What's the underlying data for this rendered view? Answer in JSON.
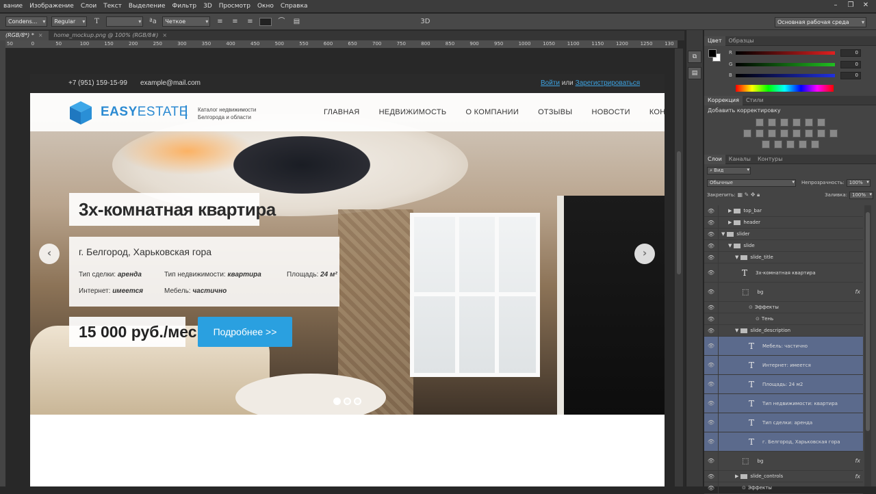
{
  "menu": [
    "вание",
    "Изображение",
    "Слои",
    "Текст",
    "Выделение",
    "Фильтр",
    "3D",
    "Просмотр",
    "Окно",
    "Справка"
  ],
  "options": {
    "font_family": "Condens...",
    "font_style": "Regular",
    "font_size": "",
    "antialias": "Четкое",
    "label_3d": "3D",
    "workspace": "Основная рабочая среда"
  },
  "tabs": [
    {
      "label": "(RGB/8*) *",
      "active": true
    },
    {
      "label": "home_mockup.png @ 100% (RGB/8#)",
      "active": false
    }
  ],
  "ruler": [
    "50",
    "0",
    "50",
    "100",
    "150",
    "200",
    "250",
    "300",
    "350",
    "400",
    "450",
    "500",
    "550",
    "600",
    "650",
    "700",
    "750",
    "800",
    "850",
    "900",
    "950",
    "1000",
    "1050",
    "1100",
    "1150",
    "1200",
    "1250",
    "130"
  ],
  "site": {
    "phone": "+7 (951) 159-15-99",
    "email": "example@mail.com",
    "login": "Войти",
    "or": "или",
    "register": "Зарегистрироваться",
    "logo_easy": "EASY",
    "logo_estate": "ESTATE",
    "catalog_line1": "Каталог недвижимости",
    "catalog_line2": "Белгорода и области",
    "nav": [
      "ГЛАВНАЯ",
      "НЕДВИЖИМОСТЬ",
      "О КОМПАНИИ",
      "ОТЗЫВЫ",
      "НОВОСТИ",
      "КОНТАКТЫ"
    ],
    "slide": {
      "title": "3х-комнатная квартира",
      "location": "г. Белгород, Харьковская гора",
      "deal_label": "Тип сделки:",
      "deal_value": "аренда",
      "type_label": "Тип недвижимости:",
      "type_value": "квартира",
      "area_label": "Площадь:",
      "area_value": "24 м²",
      "internet_label": "Интернет:",
      "internet_value": "имеется",
      "furniture_label": "Мебель:",
      "furniture_value": "частично",
      "price": "15 000 руб./мес.",
      "button": "Подробнее >>",
      "prev_arrow": "‹",
      "next_arrow": "›",
      "dots_active": 1
    }
  },
  "color_panel": {
    "tabs": [
      "Цвет",
      "Образцы"
    ],
    "channels": [
      {
        "label": "R",
        "value": "0",
        "color": "#e02020"
      },
      {
        "label": "G",
        "value": "0",
        "color": "#20c020"
      },
      {
        "label": "B",
        "value": "0",
        "color": "#2030e0"
      }
    ]
  },
  "adjust_panel": {
    "tabs": [
      "Коррекция",
      "Стили"
    ],
    "title": "Добавить корректировку"
  },
  "layers_panel": {
    "tabs": [
      "Слои",
      "Каналы",
      "Контуры"
    ],
    "filter": "Вид",
    "blend": "Обычные",
    "opacity_label": "Непрозрачность:",
    "opacity": "100%",
    "lock_label": "Закрепить:",
    "fill_label": "Заливка:",
    "fill": "100%",
    "layers": [
      {
        "name": "top_bar",
        "kind": "folder",
        "tri": "▶"
      },
      {
        "name": "header",
        "kind": "folder",
        "tri": "▶"
      },
      {
        "name": "slider",
        "kind": "folder",
        "tri": "▼"
      },
      {
        "name": "slide",
        "kind": "folder",
        "tri": "▼"
      },
      {
        "name": "slide_title",
        "kind": "folder",
        "tri": "▼"
      },
      {
        "name": "3х-комнатная квартира",
        "kind": "text"
      },
      {
        "name": "bg",
        "kind": "shape",
        "fx": "fx"
      },
      {
        "name": "Эффекты",
        "kind": "effect"
      },
      {
        "name": "Тень",
        "kind": "effect"
      },
      {
        "name": "slide_description",
        "kind": "folder",
        "tri": "▼"
      },
      {
        "name": "Мебель: частично",
        "kind": "text",
        "sel": true
      },
      {
        "name": "Интернет: имеется",
        "kind": "text",
        "sel": true
      },
      {
        "name": "Площадь: 24 м2",
        "kind": "text",
        "sel": true
      },
      {
        "name": "Тип недвижимости: квартира",
        "kind": "text",
        "sel": true
      },
      {
        "name": "Тип сделки: аренда",
        "kind": "text",
        "sel": true
      },
      {
        "name": "г. Белгород, Харьковская гора",
        "kind": "text",
        "sel": true
      },
      {
        "name": "bg",
        "kind": "shape",
        "fx": "fx"
      },
      {
        "name": "slide_controls",
        "kind": "folder",
        "tri": "▶",
        "fx": "fx"
      },
      {
        "name": "Эффекты",
        "kind": "effect"
      }
    ]
  }
}
